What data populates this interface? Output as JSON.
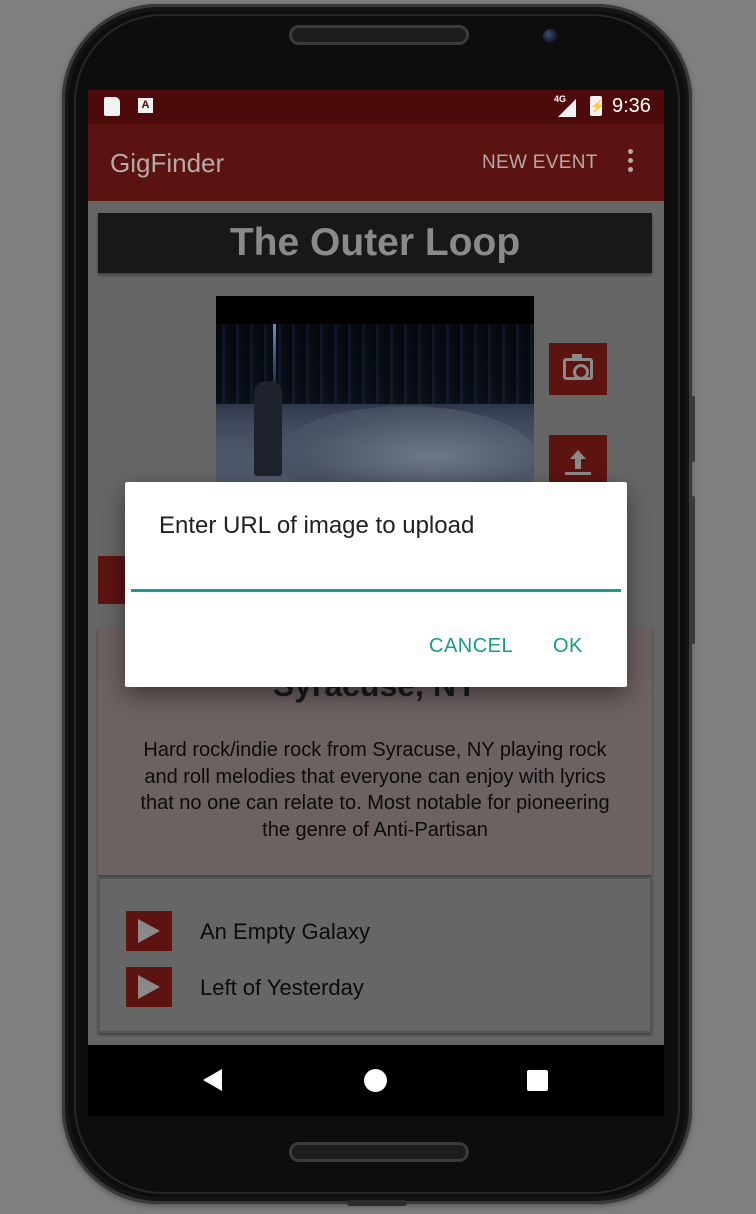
{
  "status_bar": {
    "network": "4G",
    "time": "9:36",
    "notification_icons": [
      "sd-card-icon",
      "font-a-icon"
    ]
  },
  "app_bar": {
    "title": "GigFinder",
    "action_label": "NEW EVENT",
    "overflow_icon": "more-vert-icon"
  },
  "band": {
    "name": "The Outer Loop",
    "location": "Syracuse, NY",
    "description": "Hard rock/indie rock from Syracuse, NY playing rock and roll melodies that everyone can enjoy with lyrics that no one can relate to. Most notable for pioneering the genre of Anti-Partisan",
    "camera_button_icon": "camera-icon",
    "upload_button_icon": "upload-icon"
  },
  "songs": [
    {
      "title": "An Empty Galaxy"
    },
    {
      "title": "Left of Yesterday"
    }
  ],
  "dialog": {
    "title": "Enter URL of image to upload",
    "input_value": "",
    "cancel_label": "CANCEL",
    "ok_label": "OK"
  },
  "nav_bar": {
    "back_icon": "back-triangle-icon",
    "home_icon": "home-circle-icon",
    "recents_icon": "recents-square-icon"
  },
  "colors": {
    "app_bar": "#b71c1c",
    "accent": "#1c9a8c",
    "scrim": "rgba(0,0,0,0.6)"
  }
}
